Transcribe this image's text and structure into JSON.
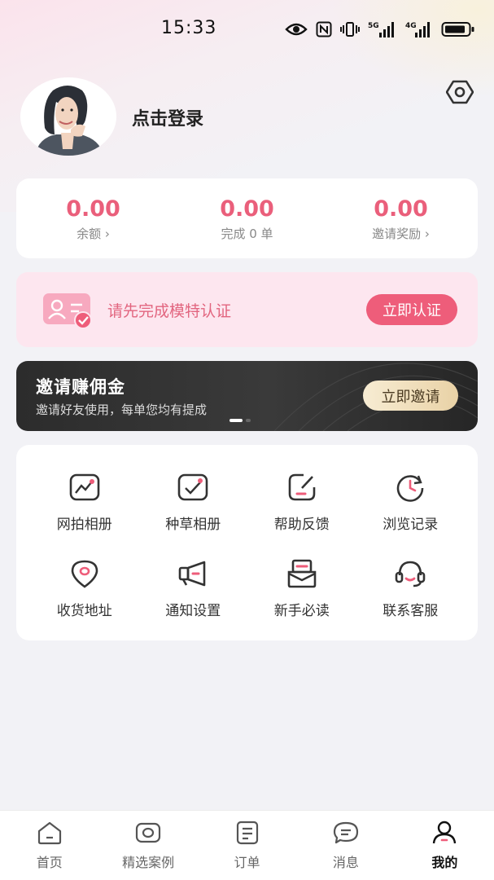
{
  "status_bar": {
    "time": "15:33",
    "icons": [
      "eye-icon",
      "nfc-icon",
      "vibrate-icon",
      "signal-5g-icon",
      "signal-4g-icon",
      "battery-icon"
    ],
    "net_labels": {
      "first": "5G",
      "second": "4G"
    }
  },
  "profile": {
    "login_label": "点击登录",
    "settings_icon": "settings-icon"
  },
  "stats": [
    {
      "value": "0.00",
      "label": "余额",
      "arrow": "›"
    },
    {
      "value": "0.00",
      "label": "完成 0 单",
      "arrow": ""
    },
    {
      "value": "0.00",
      "label": "邀请奖励",
      "arrow": "›"
    }
  ],
  "verify": {
    "text": "请先完成模特认证",
    "button": "立即认证"
  },
  "invite": {
    "title": "邀请赚佣金",
    "subtitle": "邀请好友使用，每单您均有提成",
    "button": "立即邀请",
    "carousel": {
      "count": 2,
      "active": 1
    }
  },
  "features": [
    {
      "label": "网拍相册",
      "icon": "photo-album-icon"
    },
    {
      "label": "种草相册",
      "icon": "album-check-icon"
    },
    {
      "label": "帮助反馈",
      "icon": "feedback-edit-icon"
    },
    {
      "label": "浏览记录",
      "icon": "history-clock-icon"
    },
    {
      "label": "收货地址",
      "icon": "location-pin-icon"
    },
    {
      "label": "通知设置",
      "icon": "megaphone-icon"
    },
    {
      "label": "新手必读",
      "icon": "mail-inbox-icon"
    },
    {
      "label": "联系客服",
      "icon": "headset-icon"
    }
  ],
  "tabs": [
    {
      "label": "首页",
      "icon": "home-icon",
      "active": false
    },
    {
      "label": "精选案例",
      "icon": "camera-icon",
      "active": false
    },
    {
      "label": "订单",
      "icon": "order-list-icon",
      "active": false
    },
    {
      "label": "消息",
      "icon": "message-icon",
      "active": false
    },
    {
      "label": "我的",
      "icon": "user-icon",
      "active": true
    }
  ],
  "colors": {
    "accent": "#ee5d7a",
    "stat_value": "#ea5f7b",
    "verify_bg": "#fde6ef",
    "invite_bg": "#2c2c2c",
    "gold_button": "#e9d2a6"
  }
}
